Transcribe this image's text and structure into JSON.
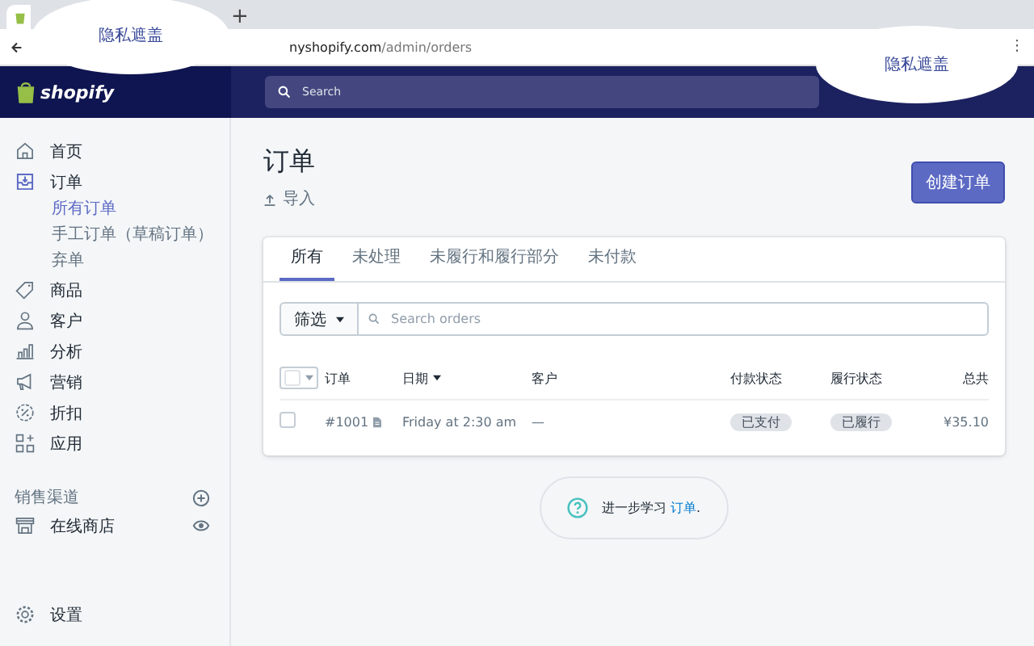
{
  "browser": {
    "new_tab": "+",
    "url_host": "nyshopify.com",
    "url_path": "/admin/orders",
    "menu": "⋮"
  },
  "privacy_masks": [
    {
      "text": "隐私遮盖"
    },
    {
      "text": "隐私遮盖"
    }
  ],
  "header": {
    "logo": "shopify",
    "search_placeholder": "Search"
  },
  "sidebar": {
    "items": [
      {
        "label": "首页",
        "selected": false
      },
      {
        "label": "订单",
        "selected": true,
        "children": [
          {
            "label": "所有订单",
            "selected": true
          },
          {
            "label": "手工订单（草稿订单）",
            "selected": false
          },
          {
            "label": "弃单",
            "selected": false
          }
        ]
      },
      {
        "label": "商品",
        "selected": false
      },
      {
        "label": "客户",
        "selected": false
      },
      {
        "label": "分析",
        "selected": false
      },
      {
        "label": "营销",
        "selected": false
      },
      {
        "label": "折扣",
        "selected": false
      },
      {
        "label": "应用",
        "selected": false
      }
    ],
    "section_label": "销售渠道",
    "channels": [
      {
        "label": "在线商店"
      }
    ],
    "settings": {
      "label": "设置"
    }
  },
  "page": {
    "title": "订单",
    "import": "导入",
    "create_button": "创建订单",
    "tabs": [
      {
        "label": "所有",
        "selected": true
      },
      {
        "label": "未处理",
        "selected": false
      },
      {
        "label": "未履行和履行部分",
        "selected": false
      },
      {
        "label": "未付款",
        "selected": false
      }
    ],
    "filter_button": "筛选",
    "search_placeholder": "Search orders",
    "columns": [
      "订单",
      "日期",
      "客户",
      "付款状态",
      "履行状态",
      "总共"
    ],
    "rows": [
      {
        "checked": false,
        "order": "#1001",
        "date": "Friday at 2:30 am",
        "customer": "—",
        "payment": "已支付",
        "fulfillment": "已履行",
        "total": "¥35.10"
      }
    ],
    "help": {
      "text": "进一步学习",
      "link": "订单",
      "end": "."
    }
  }
}
